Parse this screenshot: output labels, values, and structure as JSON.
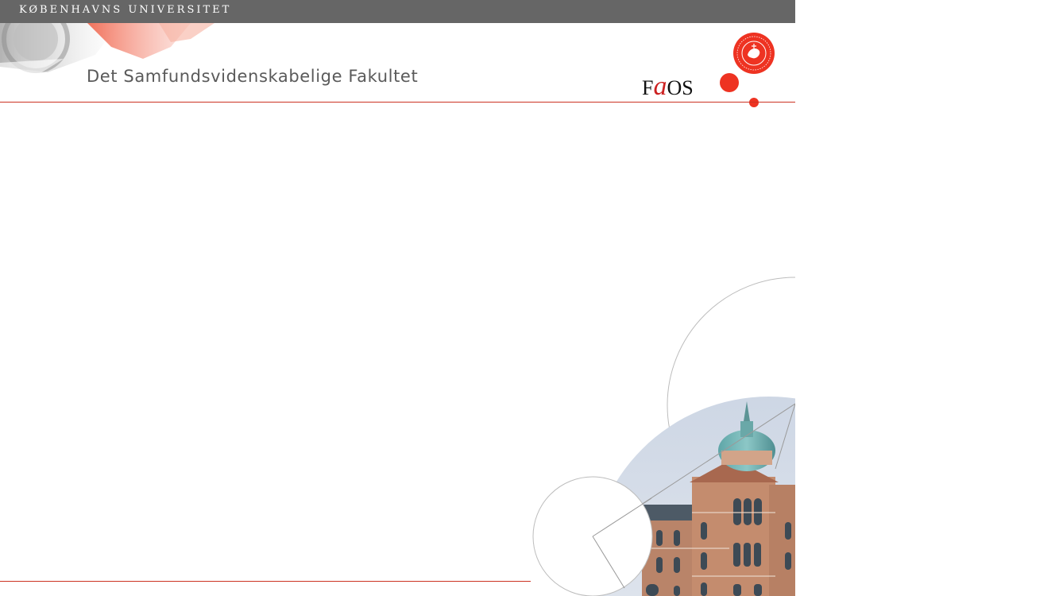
{
  "header": {
    "university_name": "KØBENHAVNS UNIVERSITET",
    "faculty_name": "Det Samfundsvidenskabelige Fakultet",
    "logo_text_prefix": "F",
    "logo_text_accent": "a",
    "logo_text_suffix": "OS"
  },
  "colors": {
    "top_bar": "#666666",
    "accent_red": "#ee3322",
    "rule_line": "#cc3322",
    "faculty_text": "#5a5a5a"
  },
  "images": {
    "header_seal": "university-seal-artwork",
    "corner_seal": "university-seal-icon",
    "building": "university-building-photo"
  }
}
